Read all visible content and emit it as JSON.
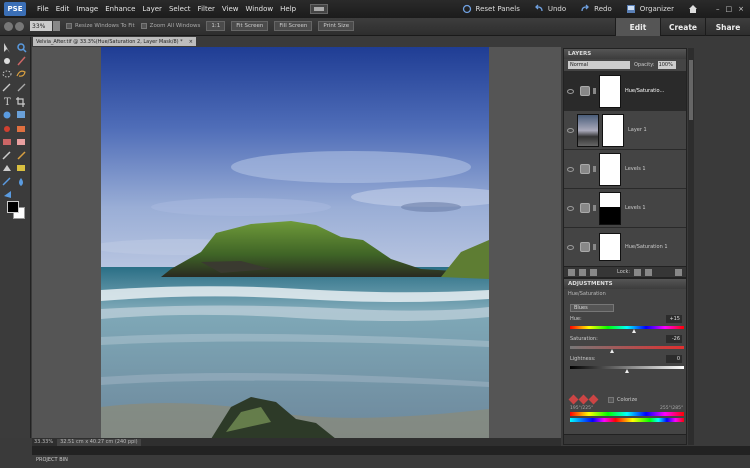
{
  "app": {
    "logo": "PSE"
  },
  "menubar": {
    "items": [
      "File",
      "Edit",
      "Image",
      "Enhance",
      "Layer",
      "Select",
      "Filter",
      "View",
      "Window",
      "Help"
    ],
    "right": {
      "reset_panels": "Reset Panels",
      "undo": "Undo",
      "redo": "Redo",
      "organizer": "Organizer"
    }
  },
  "options": {
    "zoom": "33%",
    "resize_windows": "Resize Windows To Fit",
    "zoom_all": "Zoom All Windows",
    "buttons": [
      "1:1",
      "Fit Screen",
      "Fill Screen",
      "Print Size"
    ]
  },
  "mode_tabs": {
    "edit": "Edit",
    "create": "Create",
    "share": "Share",
    "active": "Edit"
  },
  "document": {
    "tab_title": "Velvia_After.tif @ 33.3%(Hue/Saturation 2, Layer Mask/8) *"
  },
  "status": {
    "zoom": "33.33%",
    "doc_size": "32.51 cm x 40.27 cm (240 ppi)"
  },
  "project_bin": {
    "label": "PROJECT BIN"
  },
  "layers_panel": {
    "title": "LAYERS",
    "blend_mode": "Normal",
    "opacity_label": "Opacity:",
    "opacity_value": "100%",
    "lock_label": "Lock:",
    "layers": [
      {
        "name": "Hue/Saturatio...",
        "type": "adjustment",
        "selected": true,
        "mask": "white"
      },
      {
        "name": "Layer 1",
        "type": "photo",
        "selected": false,
        "mask": "white"
      },
      {
        "name": "Levels 1",
        "type": "adjustment",
        "selected": false,
        "mask": "white"
      },
      {
        "name": "Levels 1",
        "type": "adjustment",
        "selected": false,
        "mask": "black-shape"
      },
      {
        "name": "Hue/Saturation 1",
        "type": "adjustment",
        "selected": false,
        "mask": "white"
      }
    ]
  },
  "adjustments_panel": {
    "title": "ADJUSTMENTS",
    "adjustment_name": "Hue/Saturation",
    "preset": "Blues",
    "hue": {
      "label": "Hue:",
      "value": "+15",
      "position": 0.57
    },
    "saturation": {
      "label": "Saturation:",
      "value": "-26",
      "position": 0.37
    },
    "lightness": {
      "label": "Lightness:",
      "value": "0",
      "position": 0.5
    },
    "colorize": "Colorize",
    "range_left": "195°/225°",
    "range_right": "255°\\285°"
  }
}
